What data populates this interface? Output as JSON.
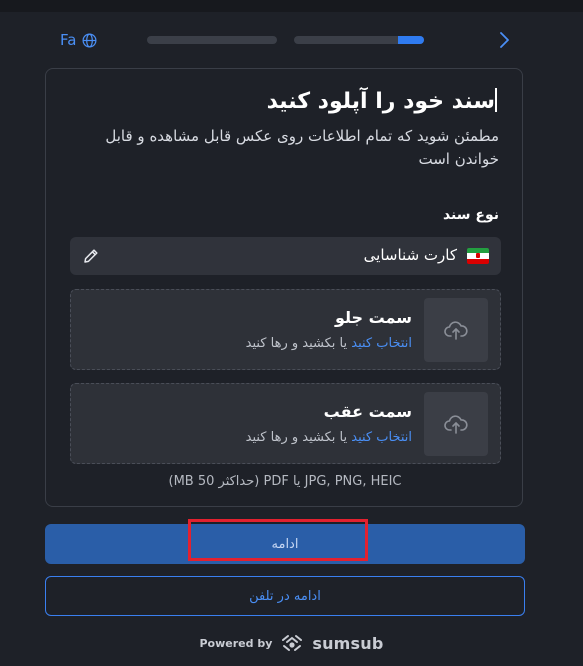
{
  "header": {
    "language_label": "Fa",
    "progress": [
      {
        "fraction": 0
      },
      {
        "fraction": 0.2
      }
    ]
  },
  "card": {
    "title": "سند خود را آپلود کنید",
    "subtitle": "مطمئن شوید که تمام اطلاعات روی عکس قابل مشاهده و قابل خواندن است",
    "doc_type_label": "نوع سند",
    "selected_document": "کارت شناسایی",
    "upload_front": {
      "title": "سمت جلو",
      "select_link": "انتخاب کنید",
      "hint_rest": "یا بکشید و رها کنید"
    },
    "upload_back": {
      "title": "سمت عقب",
      "select_link": "انتخاب کنید",
      "hint_rest": "یا بکشید و رها کنید"
    },
    "formats_note": "(MB 50 حداکثر) PDF یا JPG, PNG, HEIC"
  },
  "buttons": {
    "continue_label": "ادامه",
    "continue_on_phone_label": "ادامه در تلفن"
  },
  "footer": {
    "powered_by": "Powered by",
    "brand": "sumsub"
  },
  "colors": {
    "accent": "#4a8ff5",
    "primary_button": "#2a5ea8",
    "highlight_box": "#e3212f"
  }
}
